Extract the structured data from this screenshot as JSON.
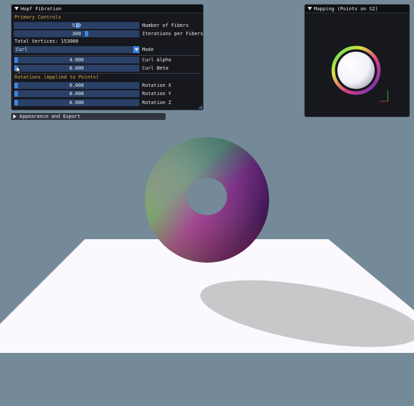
{
  "app": {
    "background_color": "#748a98",
    "accent_color": "#3d85e0",
    "section_color": "#e0a84a",
    "field_color": "#2a4066"
  },
  "panel": {
    "title": "Hopf Fibration",
    "primary_section": "Primary Controls",
    "fibers": {
      "value": "510",
      "label": "Number of Fibers",
      "fraction": 0.51
    },
    "iterations": {
      "value": "300",
      "label": "Iterations per Fibers",
      "fraction": 0.58
    },
    "total_vertices": "Total Vertices: 153000",
    "mode": {
      "value": "Curl",
      "label": "Mode"
    },
    "curl_alpha": {
      "value": "4.000",
      "label": "Curl Alpha",
      "fraction": 0.0
    },
    "curl_beta": {
      "value": "0.000",
      "label": "Curl Beta",
      "fraction": 0.0
    },
    "rotations_section": "Rotations (Applied to Points)",
    "rotation_x": {
      "value": "0.000",
      "label": "Rotation X",
      "fraction": 0.0
    },
    "rotation_y": {
      "value": "0.000",
      "label": "Rotation Y",
      "fraction": 0.0
    },
    "rotation_z": {
      "value": "0.000",
      "label": "Rotation Z",
      "fraction": 0.0
    }
  },
  "appearance": {
    "title": "Appearance and Export",
    "expanded": false
  },
  "mapping": {
    "title": "Mapping (Points on S2)"
  },
  "icons": {
    "expand": "triangle-down-icon",
    "collapsed": "triangle-right-icon",
    "combo": "chevron-down-icon",
    "cursor": "mouse-pointer-icon"
  }
}
